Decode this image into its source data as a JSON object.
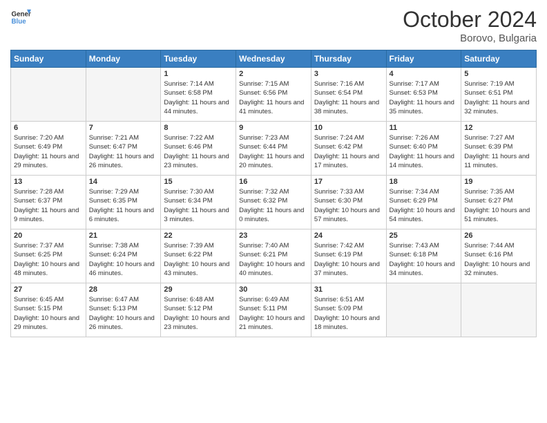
{
  "header": {
    "logo_line1": "General",
    "logo_line2": "Blue",
    "month": "October 2024",
    "location": "Borovo, Bulgaria"
  },
  "days_of_week": [
    "Sunday",
    "Monday",
    "Tuesday",
    "Wednesday",
    "Thursday",
    "Friday",
    "Saturday"
  ],
  "weeks": [
    [
      {
        "day": null,
        "info": null
      },
      {
        "day": null,
        "info": null
      },
      {
        "day": "1",
        "info": "Sunrise: 7:14 AM\nSunset: 6:58 PM\nDaylight: 11 hours and 44 minutes."
      },
      {
        "day": "2",
        "info": "Sunrise: 7:15 AM\nSunset: 6:56 PM\nDaylight: 11 hours and 41 minutes."
      },
      {
        "day": "3",
        "info": "Sunrise: 7:16 AM\nSunset: 6:54 PM\nDaylight: 11 hours and 38 minutes."
      },
      {
        "day": "4",
        "info": "Sunrise: 7:17 AM\nSunset: 6:53 PM\nDaylight: 11 hours and 35 minutes."
      },
      {
        "day": "5",
        "info": "Sunrise: 7:19 AM\nSunset: 6:51 PM\nDaylight: 11 hours and 32 minutes."
      }
    ],
    [
      {
        "day": "6",
        "info": "Sunrise: 7:20 AM\nSunset: 6:49 PM\nDaylight: 11 hours and 29 minutes."
      },
      {
        "day": "7",
        "info": "Sunrise: 7:21 AM\nSunset: 6:47 PM\nDaylight: 11 hours and 26 minutes."
      },
      {
        "day": "8",
        "info": "Sunrise: 7:22 AM\nSunset: 6:46 PM\nDaylight: 11 hours and 23 minutes."
      },
      {
        "day": "9",
        "info": "Sunrise: 7:23 AM\nSunset: 6:44 PM\nDaylight: 11 hours and 20 minutes."
      },
      {
        "day": "10",
        "info": "Sunrise: 7:24 AM\nSunset: 6:42 PM\nDaylight: 11 hours and 17 minutes."
      },
      {
        "day": "11",
        "info": "Sunrise: 7:26 AM\nSunset: 6:40 PM\nDaylight: 11 hours and 14 minutes."
      },
      {
        "day": "12",
        "info": "Sunrise: 7:27 AM\nSunset: 6:39 PM\nDaylight: 11 hours and 11 minutes."
      }
    ],
    [
      {
        "day": "13",
        "info": "Sunrise: 7:28 AM\nSunset: 6:37 PM\nDaylight: 11 hours and 9 minutes."
      },
      {
        "day": "14",
        "info": "Sunrise: 7:29 AM\nSunset: 6:35 PM\nDaylight: 11 hours and 6 minutes."
      },
      {
        "day": "15",
        "info": "Sunrise: 7:30 AM\nSunset: 6:34 PM\nDaylight: 11 hours and 3 minutes."
      },
      {
        "day": "16",
        "info": "Sunrise: 7:32 AM\nSunset: 6:32 PM\nDaylight: 11 hours and 0 minutes."
      },
      {
        "day": "17",
        "info": "Sunrise: 7:33 AM\nSunset: 6:30 PM\nDaylight: 10 hours and 57 minutes."
      },
      {
        "day": "18",
        "info": "Sunrise: 7:34 AM\nSunset: 6:29 PM\nDaylight: 10 hours and 54 minutes."
      },
      {
        "day": "19",
        "info": "Sunrise: 7:35 AM\nSunset: 6:27 PM\nDaylight: 10 hours and 51 minutes."
      }
    ],
    [
      {
        "day": "20",
        "info": "Sunrise: 7:37 AM\nSunset: 6:25 PM\nDaylight: 10 hours and 48 minutes."
      },
      {
        "day": "21",
        "info": "Sunrise: 7:38 AM\nSunset: 6:24 PM\nDaylight: 10 hours and 46 minutes."
      },
      {
        "day": "22",
        "info": "Sunrise: 7:39 AM\nSunset: 6:22 PM\nDaylight: 10 hours and 43 minutes."
      },
      {
        "day": "23",
        "info": "Sunrise: 7:40 AM\nSunset: 6:21 PM\nDaylight: 10 hours and 40 minutes."
      },
      {
        "day": "24",
        "info": "Sunrise: 7:42 AM\nSunset: 6:19 PM\nDaylight: 10 hours and 37 minutes."
      },
      {
        "day": "25",
        "info": "Sunrise: 7:43 AM\nSunset: 6:18 PM\nDaylight: 10 hours and 34 minutes."
      },
      {
        "day": "26",
        "info": "Sunrise: 7:44 AM\nSunset: 6:16 PM\nDaylight: 10 hours and 32 minutes."
      }
    ],
    [
      {
        "day": "27",
        "info": "Sunrise: 6:45 AM\nSunset: 5:15 PM\nDaylight: 10 hours and 29 minutes."
      },
      {
        "day": "28",
        "info": "Sunrise: 6:47 AM\nSunset: 5:13 PM\nDaylight: 10 hours and 26 minutes."
      },
      {
        "day": "29",
        "info": "Sunrise: 6:48 AM\nSunset: 5:12 PM\nDaylight: 10 hours and 23 minutes."
      },
      {
        "day": "30",
        "info": "Sunrise: 6:49 AM\nSunset: 5:11 PM\nDaylight: 10 hours and 21 minutes."
      },
      {
        "day": "31",
        "info": "Sunrise: 6:51 AM\nSunset: 5:09 PM\nDaylight: 10 hours and 18 minutes."
      },
      {
        "day": null,
        "info": null
      },
      {
        "day": null,
        "info": null
      }
    ]
  ]
}
